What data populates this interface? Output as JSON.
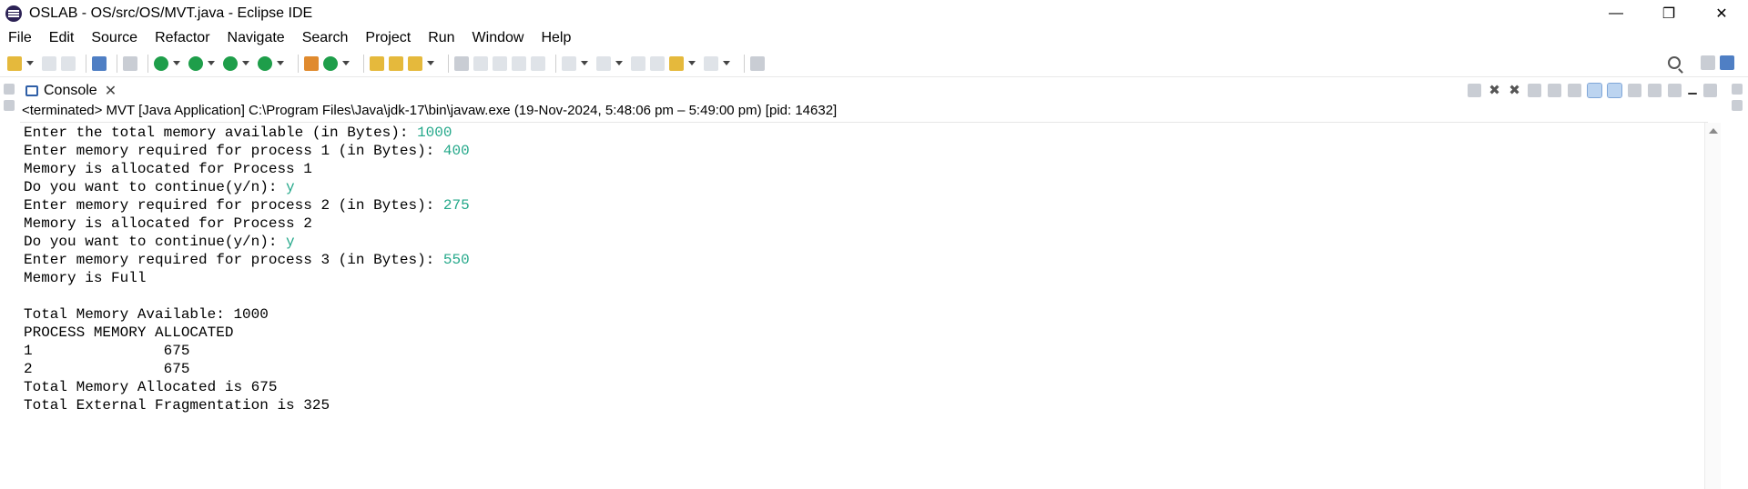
{
  "window": {
    "title": "OSLAB - OS/src/OS/MVT.java - Eclipse IDE",
    "minimize": "—",
    "restore": "❐",
    "close": "✕"
  },
  "menu": [
    "File",
    "Edit",
    "Source",
    "Refactor",
    "Navigate",
    "Search",
    "Project",
    "Run",
    "Window",
    "Help"
  ],
  "console": {
    "tab_label": "Console",
    "tab_close": "✕",
    "description": "<terminated> MVT [Java Application] C:\\Program Files\\Java\\jdk-17\\bin\\javaw.exe  (19-Nov-2024, 5:48:06 pm – 5:49:00 pm) [pid: 14632]",
    "lines": [
      {
        "text": "Enter the total memory available (in Bytes): ",
        "input": "1000"
      },
      {
        "text": "Enter memory required for process 1 (in Bytes): ",
        "input": "400"
      },
      {
        "text": "Memory is allocated for Process 1",
        "input": ""
      },
      {
        "text": "Do you want to continue(y/n): ",
        "input": "y"
      },
      {
        "text": "Enter memory required for process 2 (in Bytes): ",
        "input": "275"
      },
      {
        "text": "Memory is allocated for Process 2",
        "input": ""
      },
      {
        "text": "Do you want to continue(y/n): ",
        "input": "y"
      },
      {
        "text": "Enter memory required for process 3 (in Bytes): ",
        "input": "550"
      },
      {
        "text": "Memory is Full",
        "input": ""
      },
      {
        "text": "",
        "input": ""
      },
      {
        "text": "Total Memory Available: 1000",
        "input": ""
      },
      {
        "text": "PROCESS MEMORY ALLOCATED",
        "input": ""
      },
      {
        "text": "1               675",
        "input": ""
      },
      {
        "text": "2               675",
        "input": ""
      },
      {
        "text": "Total Memory Allocated is 675",
        "input": ""
      },
      {
        "text": "Total External Fragmentation is 325",
        "input": ""
      }
    ]
  },
  "colors": {
    "input_text": "#24a88a",
    "console_icon": "#2f5fa7"
  }
}
